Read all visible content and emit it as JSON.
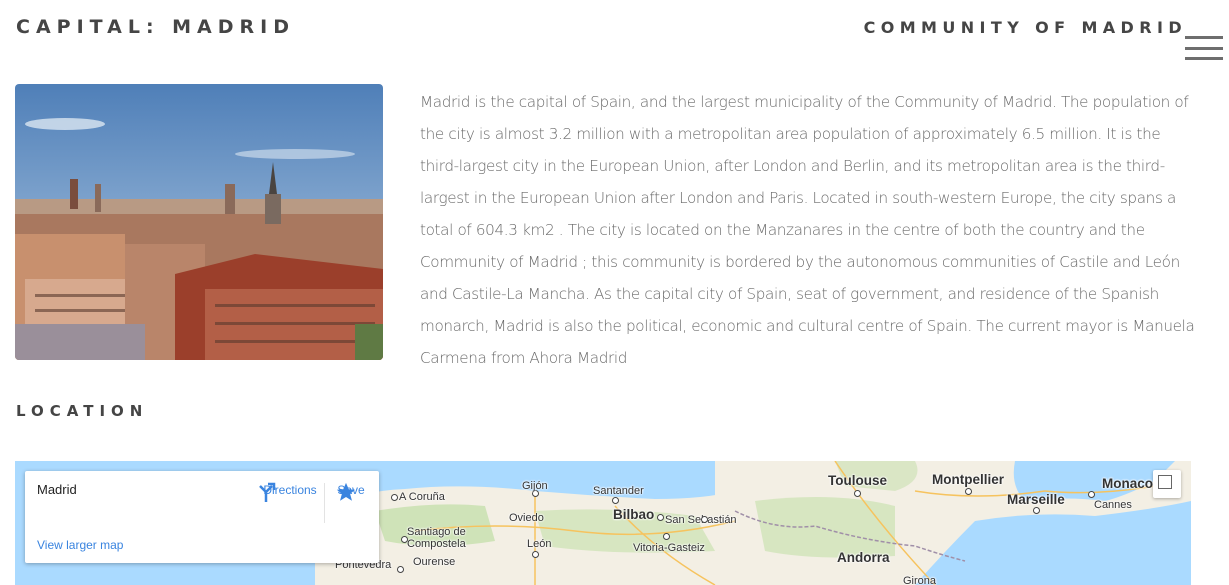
{
  "header": {
    "capital": "CAPITAL: MADRID",
    "region": "COMMUNITY OF MADRID"
  },
  "menu": {
    "icon": "hamburger-icon"
  },
  "photo": {
    "subject": "madrid-cityscape-image"
  },
  "description": "Madrid is the capital of Spain, and the largest municipality of the Community of Madrid. The population of the city is almost 3.2 million with a metropolitan area population of approximately 6.5 million. It is the third-largest city in the European Union, after London and Berlin, and its metropolitan area is the third-largest in the European Union after London and Paris. Located in south-western Europe, the city spans a total of 604.3 km2 . The city is located on the Manzanares in the centre of both the country and the Community of Madrid ; this community is bordered by the autonomous communities of Castile and León and Castile-La Mancha. As the capital city of Spain, seat of government, and residence of the Spanish monarch, Madrid is also the political, economic and cultural centre of Spain. The current mayor is Manuela Carmena from Ahora Madrid",
  "location": {
    "heading": "LOCATION",
    "card": {
      "place": "Madrid",
      "directions": "Directions",
      "save": "Save",
      "larger_map": "View larger map"
    },
    "cities": {
      "gijon": "Gijón",
      "oviedo": "Oviedo",
      "coruna": "A Coruña",
      "santander": "Santander",
      "bilbao": "Bilbao",
      "san_sebastian": "San Sebastián",
      "santiago": "Santiago de\nCompostela",
      "leon": "León",
      "vitoria": "Vitoria-Gasteiz",
      "ourense": "Ourense",
      "pontevedra": "Pontevedra",
      "toulouse": "Toulouse",
      "montpellier": "Montpellier",
      "marseille": "Marseille",
      "monaco": "Monaco",
      "cannes": "Cannes",
      "andorra": "Andorra",
      "girona": "Girona"
    },
    "colors": {
      "sea": "#aadaff",
      "land": "#f3efe4",
      "green": "#cfe3b8"
    }
  }
}
